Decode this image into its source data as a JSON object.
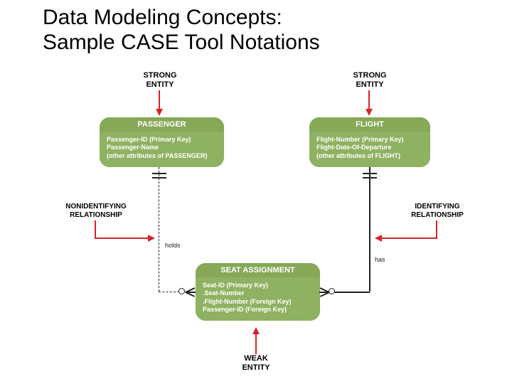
{
  "title": "Data Modeling Concepts:\nSample CASE Tool Notations",
  "labels": {
    "strong_left": "STRONG\nENTITY",
    "strong_right": "STRONG\nENTITY",
    "nonidentifying": "NONIDENTIFYING\nRELATIONSHIP",
    "identifying": "IDENTIFYING\nRELATIONSHIP",
    "weak": "WEAK\nENTITY"
  },
  "relations": {
    "holds": "holds",
    "has": "has"
  },
  "entities": {
    "passenger": {
      "name": "PASSENGER",
      "attrs": [
        "Passenger-ID (Primary Key)",
        "Passenger-Name",
        "(other attributes of PASSENGER)"
      ]
    },
    "flight": {
      "name": "FLIGHT",
      "attrs": [
        "Flight-Number (Primary Key)",
        "Flight-Date-Of-Departure",
        "(other attributes of FLIGHT)"
      ]
    },
    "seat": {
      "name": "SEAT ASSIGNMENT",
      "attrs": [
        "Seat-ID (Primary Key)",
        ".Seat-Number",
        ".Flight-Number (Foreign Key)",
        "Passenger-ID (Foreign Key)"
      ]
    }
  }
}
